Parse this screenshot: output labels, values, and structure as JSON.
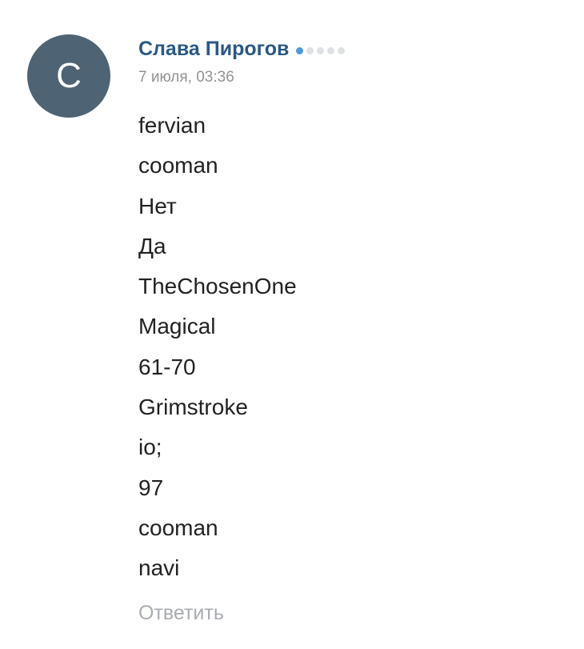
{
  "comment": {
    "avatar_letter": "С",
    "avatar_color": "#4e6374",
    "author": "Слава Пирогов",
    "rating": {
      "filled": 1,
      "total": 5
    },
    "date": "7 июля, 03:36",
    "lines": [
      "fervian",
      "cooman",
      "Нет",
      "Да",
      "TheChosenOne",
      "Magical",
      "61-70",
      "Grimstroke",
      "io;",
      "97",
      "cooman",
      "navi"
    ],
    "reply_label": "Ответить"
  },
  "colors": {
    "author_link": "#2a5885",
    "rating_active": "#4a9ad8",
    "rating_inactive": "#dde1e6",
    "muted_text": "#939393",
    "body_text": "#222222"
  }
}
